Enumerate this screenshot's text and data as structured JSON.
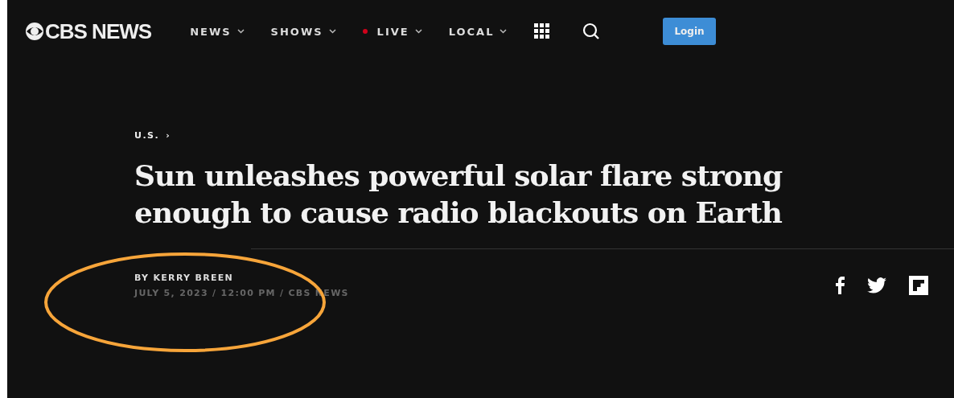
{
  "logo": {
    "text": "CBS NEWS"
  },
  "nav": [
    {
      "label": "NEWS",
      "live": false
    },
    {
      "label": "SHOWS",
      "live": false
    },
    {
      "label": "LIVE",
      "live": true
    },
    {
      "label": "LOCAL",
      "live": false
    }
  ],
  "login": {
    "label": "Login"
  },
  "article": {
    "breadcrumb": "U.S.",
    "breadcrumb_arrow": "›",
    "headline": "Sun unleashes powerful solar flare strong enough to cause radio blackouts on Earth",
    "byline": "BY KERRY BREEN",
    "dateline": "JULY 5, 2023 / 12:00 PM / CBS NEWS"
  }
}
